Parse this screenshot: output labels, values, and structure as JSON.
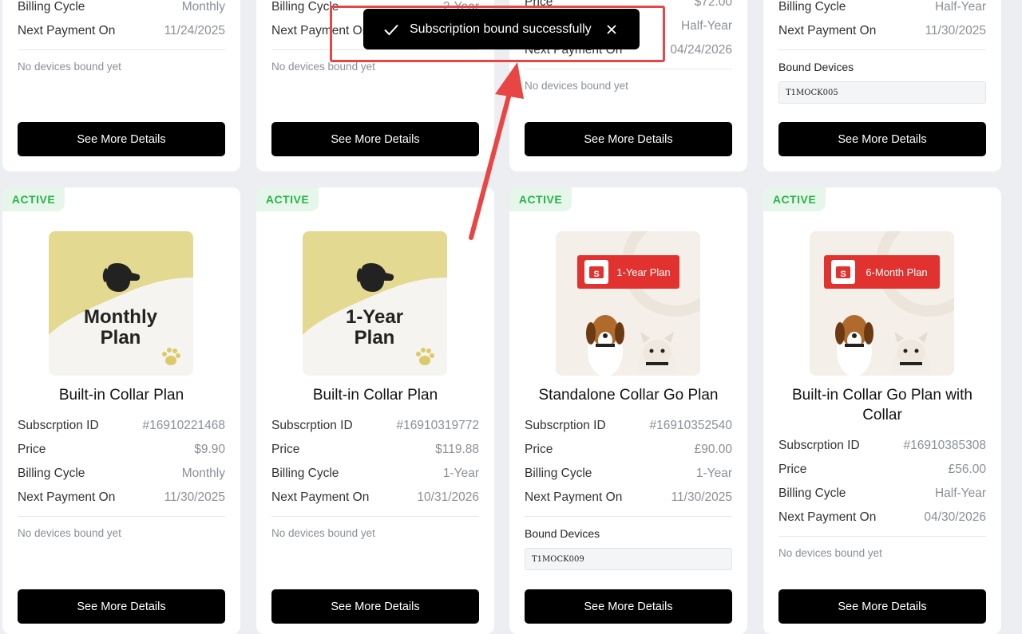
{
  "toast": {
    "message": "Subscription bound successfully",
    "check_icon": "check-icon",
    "close_icon": "close-icon"
  },
  "labels": {
    "subscription_id": "Subscrption ID",
    "price": "Price",
    "billing_cycle": "Billing Cycle",
    "next_payment": "Next Payment On",
    "no_devices": "No devices bound yet",
    "bound_devices": "Bound Devices",
    "see_more": "See More Details",
    "active": "ACTIVE"
  },
  "top_row": [
    {
      "billing_cycle": "Monthly",
      "next_payment": "11/24/2025",
      "device": null
    },
    {
      "billing_cycle": "2-Year",
      "next_payment": "",
      "device": null
    },
    {
      "price": "$72.00",
      "billing_cycle": "Half-Year",
      "next_payment": "04/24/2026",
      "device": null
    },
    {
      "billing_cycle": "Half-Year",
      "next_payment": "11/30/2025",
      "device": "T1MOCK005"
    }
  ],
  "bottom_row": [
    {
      "image_text_1": "Monthly",
      "image_text_2": "Plan",
      "title": "Built-in Collar Plan",
      "subscription_id": "#16910221468",
      "price": "$9.90",
      "billing_cycle": "Monthly",
      "next_payment": "11/30/2025",
      "device": null
    },
    {
      "image_text_1": "1-Year",
      "image_text_2": "Plan",
      "title": "Built-in Collar Plan",
      "subscription_id": "#16910319772",
      "price": "$119.88",
      "billing_cycle": "1-Year",
      "next_payment": "10/31/2026",
      "device": null
    },
    {
      "image_text_1": "1-Year Plan",
      "title": "Standalone Collar Go Plan",
      "subscription_id": "#16910352540",
      "price": "£90.00",
      "billing_cycle": "1-Year",
      "next_payment": "11/30/2025",
      "device": "T1MOCK009"
    },
    {
      "image_text_1": "6-Month Plan",
      "title": "Built-in Collar Go Plan with Collar",
      "subscription_id": "#16910385308",
      "price": "£56.00",
      "billing_cycle": "Half-Year",
      "next_payment": "04/30/2026",
      "device": null
    }
  ],
  "colors": {
    "accent_red": "#e84545",
    "active_green": "#27b34a",
    "button_black": "#000000",
    "page_bg": "#eceef2"
  }
}
